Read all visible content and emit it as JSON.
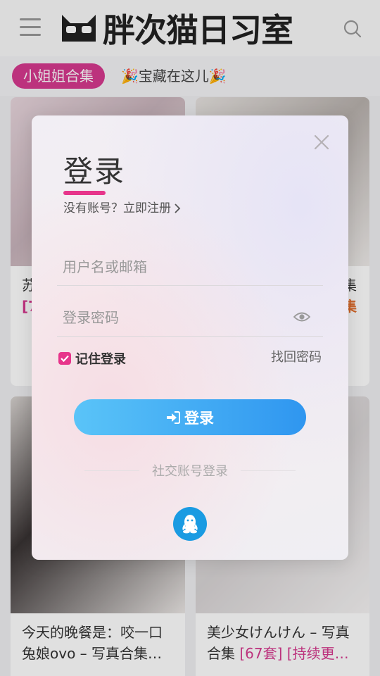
{
  "header": {
    "logo_text": "胖次猫日习室",
    "tag_label": "小姐姐合集",
    "tag_subtitle": "🎉宝藏在这儿🎉"
  },
  "cards": [
    {
      "title_partial": "苏",
      "badge_partial": "[7"
    },
    {
      "title_partial": "集",
      "badge_partial": "集"
    },
    {
      "title": "今天的晚餐是：咬一口",
      "title2": "兔娘ovo – 写真合集…"
    },
    {
      "title": "美少女けんけん – 写真",
      "title2_plain": "合集 ",
      "title2_hl": "[67套] [持续更…"
    }
  ],
  "login": {
    "title": "登录",
    "register_prompt": "没有账号？立即注册",
    "username_placeholder": "用户名或邮箱",
    "password_placeholder": "登录密码",
    "remember_label": "记住登录",
    "remember_checked": true,
    "forgot_label": "找回密码",
    "submit_label": "登录",
    "social_label": "社交账号登录",
    "accent_color": "#e7358b",
    "button_color": "#2f96f0"
  },
  "icons": [
    "menu-icon",
    "search-icon",
    "close-icon",
    "eye-icon",
    "sign-in-icon",
    "qq-icon",
    "chevron-right-icon",
    "check-icon"
  ]
}
